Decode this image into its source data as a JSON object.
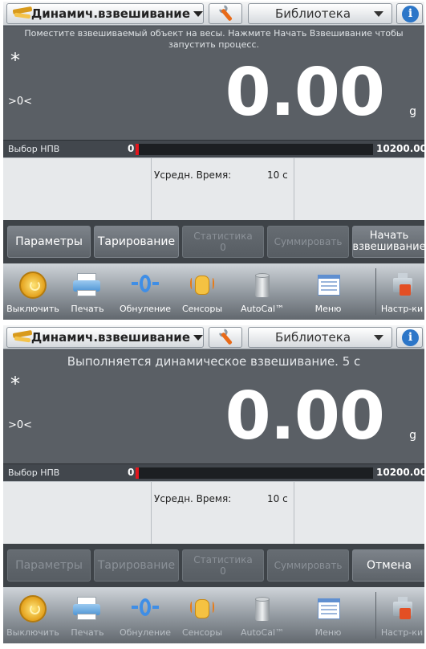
{
  "screens": [
    {
      "app_label": "Динамич.взвешивание",
      "library_label": "Библиотека",
      "info_label": "i",
      "message": "Поместите взвешиваемый объект на весы. Нажмите Начать Взвешивание чтобы запустить процесс.",
      "stable_indicator": "*",
      "center_zero_indicator": ">0<",
      "weight_value": "0.00",
      "unit": "g",
      "capacity_label": "Выбор НПВ",
      "capacity_min": "0",
      "capacity_max": "10200.00",
      "capacity_fraction": 0.01,
      "ref_label": "Усредн. Время:",
      "ref_value": "10 c",
      "softkeys": [
        {
          "label": "Параметры",
          "enabled": true
        },
        {
          "label": "Тарирование",
          "enabled": true
        },
        {
          "label": "Статистика",
          "sub": "0",
          "enabled": false
        },
        {
          "label": "Суммировать",
          "enabled": false
        },
        {
          "label": "Начать",
          "sub": "взвешивание",
          "enabled": true
        }
      ],
      "nav": [
        "Выключить",
        "Печать",
        "Обнуление",
        "Сенсоры",
        "AutoCal™",
        "Меню",
        "Настр-ки"
      ]
    },
    {
      "app_label": "Динамич.взвешивание",
      "library_label": "Библиотека",
      "info_label": "i",
      "message": "Выполняется динамическое взвешивание. 5 с",
      "stable_indicator": "*",
      "center_zero_indicator": ">0<",
      "weight_value": "0.00",
      "unit": "g",
      "capacity_label": "Выбор НПВ",
      "capacity_min": "0",
      "capacity_max": "10200.00",
      "capacity_fraction": 0.01,
      "ref_label": "Усредн. Время:",
      "ref_value": "10 c",
      "softkeys": [
        {
          "label": "Параметры",
          "enabled": false
        },
        {
          "label": "Тарирование",
          "enabled": false
        },
        {
          "label": "Статистика",
          "sub": "0",
          "enabled": false
        },
        {
          "label": "Суммировать",
          "enabled": false
        },
        {
          "label": "Отмена",
          "enabled": true
        }
      ],
      "nav": [
        "Выключить",
        "Печать",
        "Обнуление",
        "Сенсоры",
        "AutoCal™",
        "Меню",
        "Настр-ки"
      ],
      "nav_dimmed": true
    }
  ],
  "colors": {
    "capacity_fill": "#e3161d",
    "info_blue": "#2c76c8"
  },
  "icons": [
    "scale-app-icon",
    "wrench-icon",
    "info-icon",
    "power-icon",
    "printer-icon",
    "zero-icon",
    "sensor-hand-icon",
    "autocal-weight-icon",
    "menu-icon",
    "setup-icon"
  ]
}
